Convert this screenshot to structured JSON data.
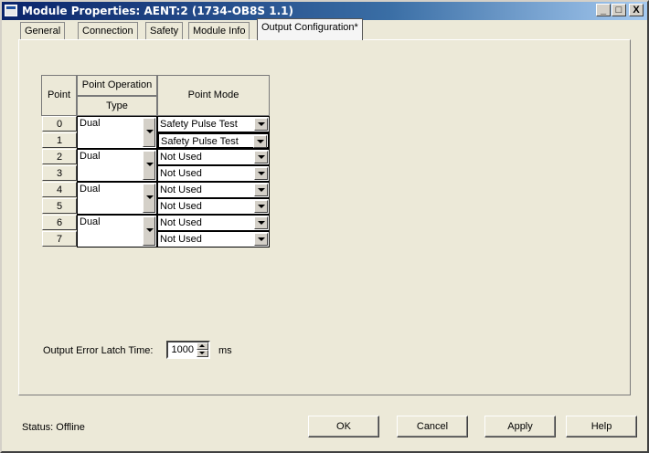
{
  "window": {
    "title": "Module Properties: AENT:2 (1734-OB8S 1.1)",
    "minimize": "_",
    "maximize": "□",
    "close": "X"
  },
  "tabs": [
    {
      "label": "General",
      "active": false
    },
    {
      "label": "Connection",
      "active": false
    },
    {
      "label": "Safety",
      "active": false
    },
    {
      "label": "Module Info",
      "active": false
    },
    {
      "label": "Output Configuration*",
      "active": true
    }
  ],
  "grid": {
    "col_point": "Point",
    "col_point_operation": "Point Operation",
    "col_type": "Type",
    "col_point_mode": "Point Mode",
    "points": [
      "0",
      "1",
      "2",
      "3",
      "4",
      "5",
      "6",
      "7"
    ],
    "types": [
      "Dual",
      "Dual",
      "Dual",
      "Dual"
    ],
    "modes": [
      "Safety Pulse Test",
      "Safety Pulse Test",
      "Not Used",
      "Not Used",
      "Not Used",
      "Not Used",
      "Not Used",
      "Not Used"
    ]
  },
  "latch": {
    "label": "Output Error Latch Time:",
    "value": "1000",
    "unit": "ms"
  },
  "status": "Status:  Offline",
  "buttons": {
    "ok": "OK",
    "cancel": "Cancel",
    "apply": "Apply",
    "help": "Help"
  }
}
